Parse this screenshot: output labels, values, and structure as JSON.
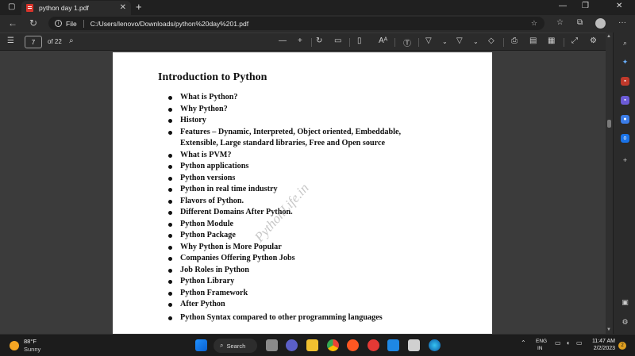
{
  "browser": {
    "tab_title": "python day 1.pdf",
    "new_tab_label": "+",
    "address_scheme": "File",
    "address_path": "C:/Users/lenovo/Downloads/python%20day%201.pdf"
  },
  "pdf_toolbar": {
    "current_page": "7",
    "page_count_label": "of 22"
  },
  "document": {
    "title": "Introduction to Python",
    "items": [
      "What is Python?",
      "Why Python?",
      "History",
      "Features – Dynamic, Interpreted, Object oriented, Embeddable, Extensible, Large standard libraries, Free and Open source",
      "What is PVM?",
      "Python applications",
      "Python versions",
      "Python in real time industry",
      "Flavors of Python.",
      "Different Domains After Python.",
      "Python Module",
      "Python Package",
      "Why Python is More Popular",
      "Companies Offering Python Jobs",
      "Job Roles in Python",
      "Python Library",
      "Python Framework",
      "After Python",
      "Python Syntax compared to other programming languages"
    ],
    "watermark": "PythonLife.in"
  },
  "taskbar": {
    "weather_temp": "88°F",
    "weather_condition": "Sunny",
    "search_label": "Search",
    "lang_line1": "ENG",
    "lang_line2": "IN",
    "time": "11:47 AM",
    "date": "2/2/2023",
    "notification_count": "2"
  },
  "colors": {
    "accent_edge_blue": "#1a73e8",
    "pdf_red": "#d7342b",
    "weather_sun": "#f5a623"
  }
}
